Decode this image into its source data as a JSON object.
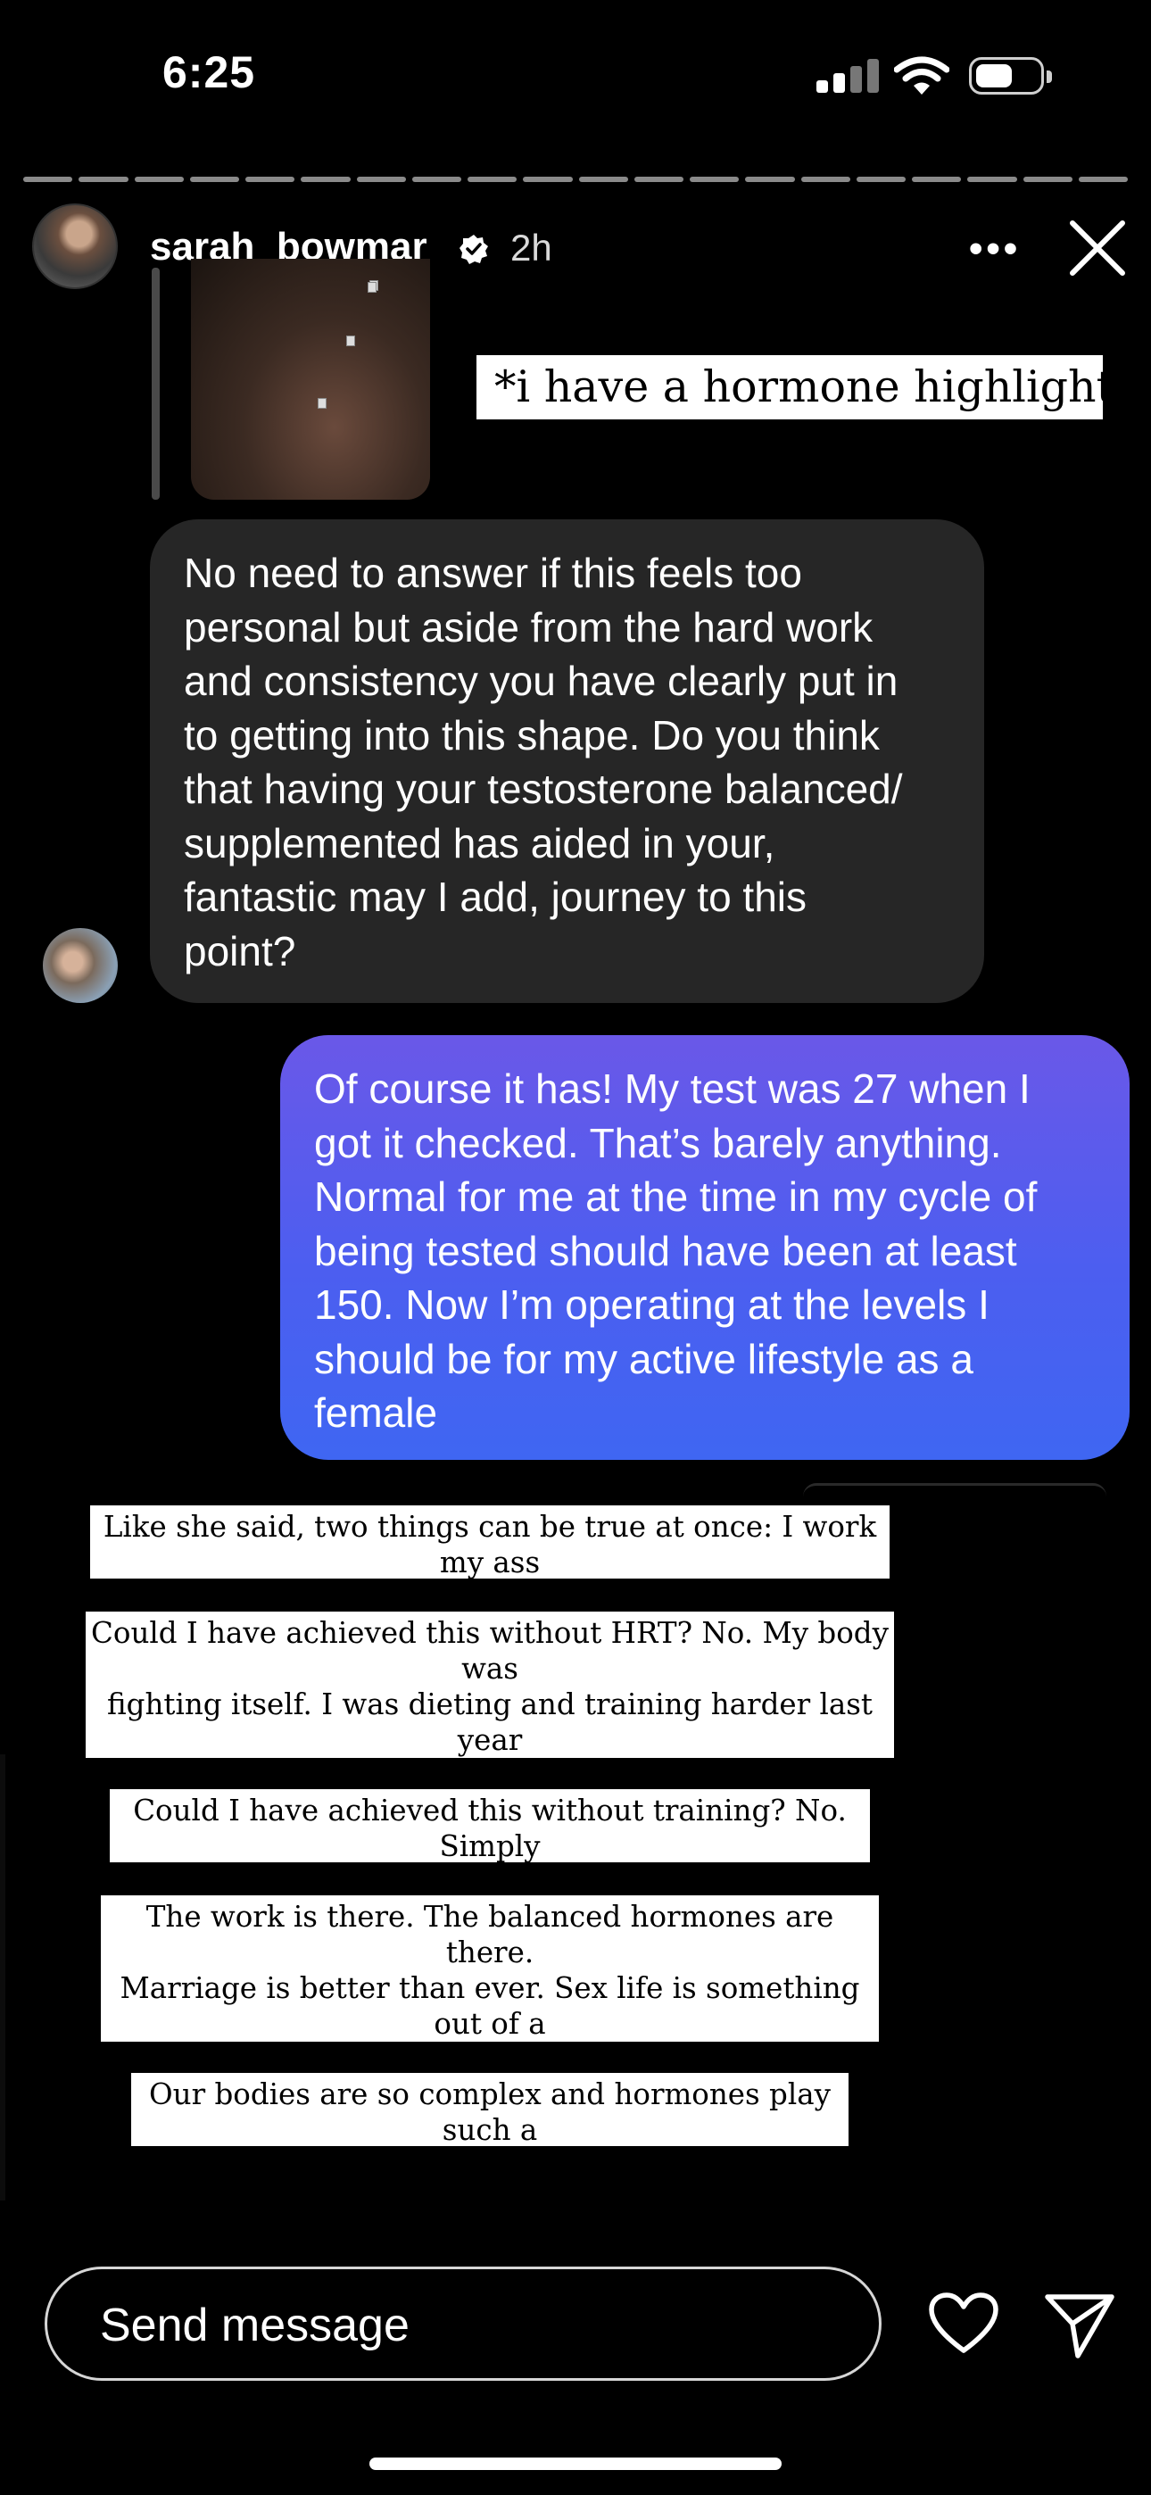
{
  "status_bar": {
    "time": "6:25"
  },
  "story": {
    "progress_segments": 20,
    "username": "sarah_bowmar",
    "time_ago": "2h",
    "more_label": "•••"
  },
  "highlight_caption": "*i have a hormone highlight",
  "messages": {
    "incoming": "No need to answer if this feels too\npersonal but aside from the hard work\nand consistency you have clearly put in\nto getting into this shape. Do you think\nthat having your testosterone balanced/\nsupplemented has aided in your,\nfantastic may I add, journey to this\npoint?",
    "outgoing": "Of course it has! My test was 27 when I\ngot it checked. That’s barely anything.\nNormal for me at the time in my cycle of\nbeing tested should have been at least\n150. Now I’m operating at the levels I\nshould be for my active lifestyle as a\nfemale"
  },
  "stickers": [
    "Like she said, two things can be true at once: I work my ass\noff and I’m on HRT.",
    "Could I have achieved this without HRT? No. My body was\nfighting itself. I was dieting and training harder last year\nthan I am now and I was retaining so much body fat and\nwater while losing muscle.",
    "Could I have achieved this without training? No. Simply\nbeing on HRT won’t result in my results.",
    "The work is there. The balanced hormones are there.\nMarriage is better than ever. Sex life is something out of a\nmovie. Anxiety is gone. Depression is gone. Stress is low.\nHRV is better than it’s ever been. Recovery is faster.",
    "Our bodies are so complex and hormones play such a\npivotal role in every function of our lives"
  ],
  "reply": {
    "placeholder": "Send message"
  },
  "icons": [
    "signal-icon",
    "wifi-icon",
    "battery-icon",
    "verified-badge-icon",
    "more-icon",
    "close-icon",
    "heart-icon",
    "send-icon"
  ],
  "colors": {
    "bubble_incoming": "#262626",
    "bubble_outgoing": "#4c5ef0",
    "background": "#000000"
  }
}
